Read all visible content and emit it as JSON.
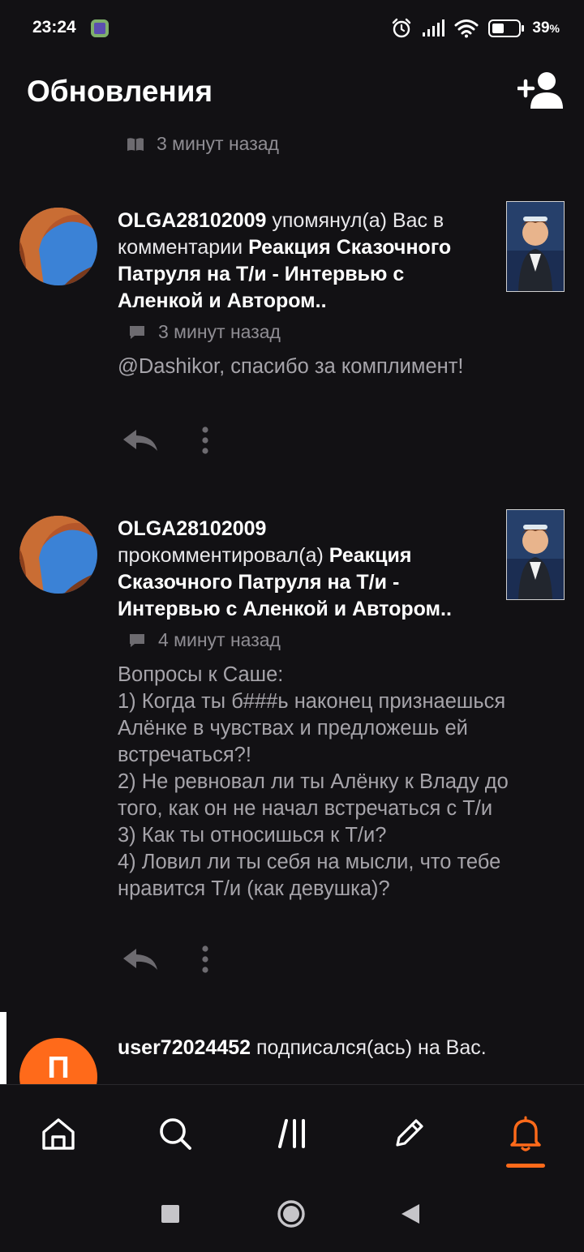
{
  "status_bar": {
    "time": "23:24",
    "battery_percent": "39",
    "battery_unit": "%",
    "icons": [
      "app-notification-icon",
      "alarm-icon",
      "signal-icon",
      "wifi-icon",
      "battery-icon"
    ]
  },
  "header": {
    "title": "Обновления",
    "add_friend_icon": "add-person-icon"
  },
  "feed": {
    "top_partial": {
      "time": "3 минут назад",
      "icon": "book-icon"
    },
    "notifications": [
      {
        "type": "mention",
        "user": "OLGA28102009",
        "action": " упомянул(а) Вас в комментарии ",
        "story": "Реакция Сказочного Патруля на Т/и - Интервью с Аленкой и Автором..",
        "time": "3 минут назад",
        "comment": "@Dashikor, спасибо за комплимент!",
        "icon": "comment-icon"
      },
      {
        "type": "comment",
        "user": "OLGA28102009",
        "action": " прокомментировал(а) ",
        "story": "Реакция Сказочного Патруля на Т/и - Интервью с Аленкой и Автором..",
        "time": "4 минут назад",
        "comment": "Вопросы к Саше:\n1) Когда ты б###ь наконец признаешься Алёнке в чувствах и предложешь ей встречаться?!\n2) Не ревновал ли ты Алёнку к Владу до того, как он не начал встречаться с Т/и\n3) Как ты относишься к Т/и?\n4) Ловил ли ты себя на мысли, что тебе нравится Т/и (как девушка)?",
        "icon": "comment-icon"
      },
      {
        "type": "follow",
        "user": "user72024452",
        "action": " подписался(ась) на Вас.",
        "avatar_letter": "П"
      }
    ]
  },
  "bottom_nav": {
    "items": [
      "home-icon",
      "search-icon",
      "library-icon",
      "write-icon",
      "notifications-bell-icon"
    ],
    "active": "notifications-bell-icon",
    "active_color": "#ff6a1a"
  },
  "system_nav": [
    "recents-button",
    "home-button",
    "back-button"
  ]
}
